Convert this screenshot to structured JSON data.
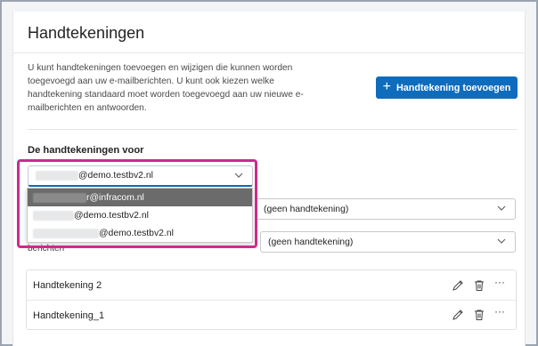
{
  "page": {
    "title": "Handtekeningen",
    "description": "U kunt handtekeningen toevoegen en wijzigen die kunnen worden toegevoegd aan uw e-mailberichten. U kunt ook kiezen welke handtekening standaard moet worden toegevoegd aan uw nieuwe e-mailberichten en antwoorden.",
    "add_button_label": "Handtekening toevoegen",
    "section_label": "De handtekeningen voor"
  },
  "account_select": {
    "value_suffix": "@demo.testbv2.nl"
  },
  "dropdown": {
    "items": [
      {
        "suffix": "r@infracom.nl",
        "active": true
      },
      {
        "suffix": "@demo.testbv2.nl",
        "active": false
      },
      {
        "suffix": "@demo.testbv2.nl",
        "active": false
      }
    ]
  },
  "defaults": {
    "new_messages_value": "(geen handtekening)",
    "replies_value": "(geen handtekening)",
    "replies_label_fragment": "berichten"
  },
  "signatures": [
    {
      "name": "Handtekening 2"
    },
    {
      "name": "Handtekening_1"
    }
  ],
  "icons": {
    "add": "plus-icon",
    "chevron": "chevron-down-icon",
    "edit": "pencil-icon",
    "delete": "trash-icon",
    "more": "more-horizontal-icon"
  },
  "colors": {
    "accent": "#0f6cbd",
    "highlight": "#d0298d",
    "dropdown_active": "#6b6b6b"
  }
}
